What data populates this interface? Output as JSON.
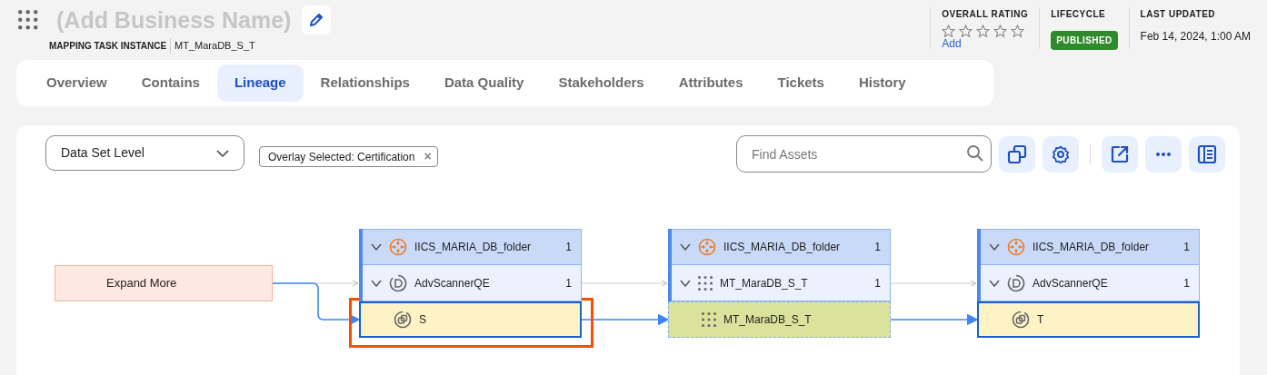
{
  "header": {
    "title": "(Add Business Name)",
    "type_label": "MAPPING TASK INSTANCE",
    "name": "MT_MaraDB_S_T"
  },
  "meta": {
    "rating": {
      "label": "OVERALL RATING",
      "stars": 0,
      "action": "Add"
    },
    "lifecycle": {
      "label": "LIFECYCLE",
      "status": "PUBLISHED"
    },
    "updated": {
      "label": "LAST UPDATED",
      "value": "Feb 14, 2024, 1:00 AM"
    }
  },
  "tabs": [
    {
      "label": "Overview",
      "selected": false
    },
    {
      "label": "Contains",
      "selected": false
    },
    {
      "label": "Lineage",
      "selected": true
    },
    {
      "label": "Relationships",
      "selected": false
    },
    {
      "label": "Data Quality",
      "selected": false
    },
    {
      "label": "Stakeholders",
      "selected": false
    },
    {
      "label": "Attributes",
      "selected": false
    },
    {
      "label": "Tickets",
      "selected": false
    },
    {
      "label": "History",
      "selected": false
    }
  ],
  "toolbar": {
    "level_select": "Data Set Level",
    "overlay_chip": "Overlay Selected: Certification",
    "chip_close": "×",
    "search": {
      "placeholder": "Find Assets"
    },
    "button_groups": [
      [
        {
          "kind": "copy"
        },
        {
          "kind": "settings"
        }
      ],
      [
        {
          "kind": "export"
        },
        {
          "kind": "more"
        },
        {
          "kind": "panel"
        }
      ]
    ]
  },
  "lineage": {
    "expand_node": {
      "label": "Expand More"
    },
    "columns": [
      {
        "rows": [
          {
            "kind": "folder",
            "label": "IICS_MARIA_DB_folder",
            "count": "1",
            "expanded": true
          },
          {
            "kind": "scanner",
            "label": "AdvScannerQE",
            "count": "1",
            "expanded": true
          },
          {
            "kind": "dataset",
            "label": "S",
            "selected": true
          }
        ]
      },
      {
        "rows": [
          {
            "kind": "folder",
            "label": "IICS_MARIA_DB_folder",
            "count": "1",
            "expanded": true
          },
          {
            "kind": "task",
            "label": "MT_MaraDB_S_T",
            "count": "1",
            "expanded": true
          },
          {
            "kind": "task_instance",
            "label": "MT_MaraDB_S_T",
            "selected": false
          }
        ]
      },
      {
        "rows": [
          {
            "kind": "folder",
            "label": "IICS_MARIA_DB_folder",
            "count": "1",
            "expanded": true
          },
          {
            "kind": "scanner",
            "label": "AdvScannerQE",
            "count": "1",
            "expanded": true
          },
          {
            "kind": "dataset",
            "label": "T",
            "selected": false
          }
        ]
      }
    ]
  }
}
